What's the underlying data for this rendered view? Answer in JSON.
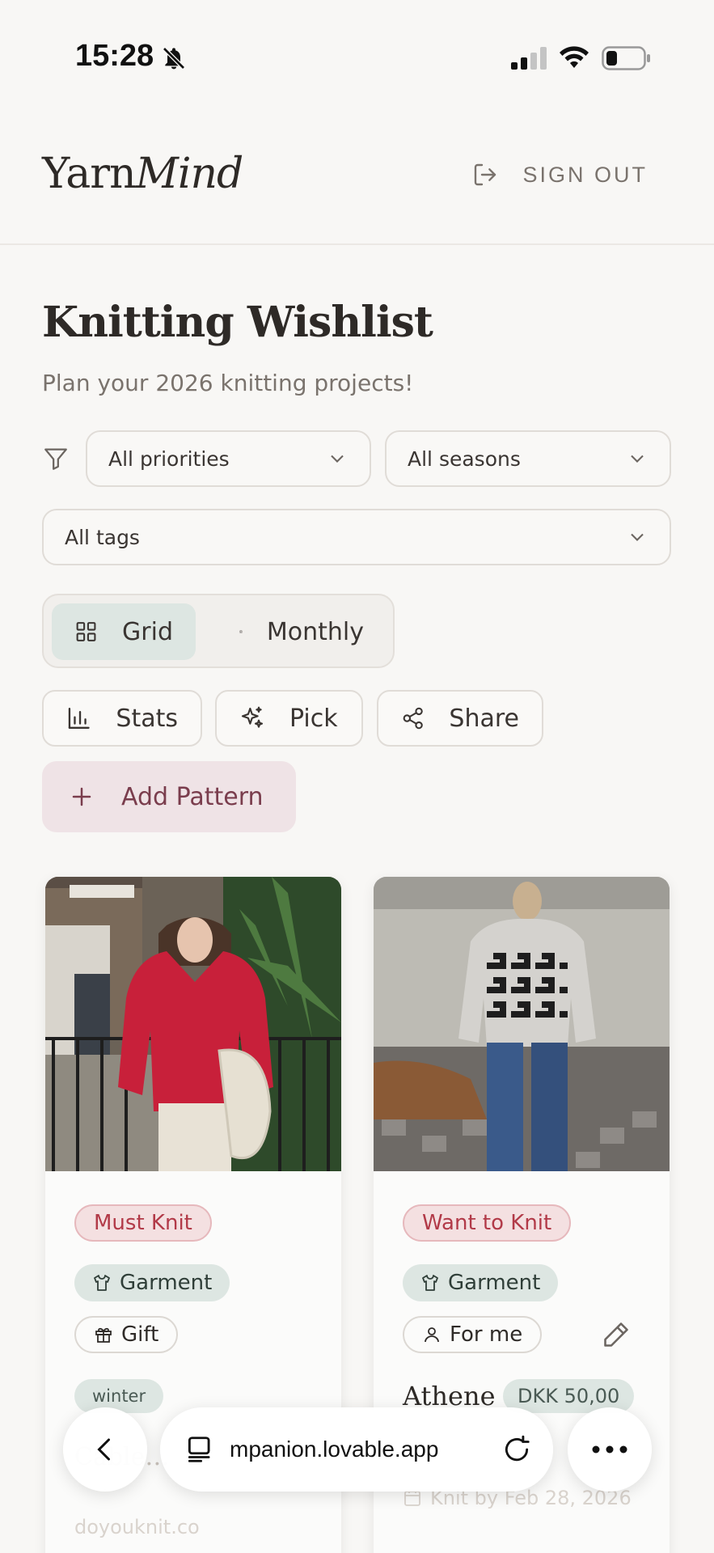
{
  "status_bar": {
    "time": "15:28"
  },
  "header": {
    "logo_part1": "Yarn",
    "logo_part2": "Mind",
    "signout_label": "SIGN OUT"
  },
  "page": {
    "title": "Knitting Wishlist",
    "subtitle": "Plan your 2026 knitting projects!"
  },
  "filters": {
    "priority": "All priorities",
    "season": "All seasons",
    "tags": "All tags"
  },
  "view_toggle": {
    "grid": "Grid",
    "monthly": "Monthly",
    "selected": "Grid"
  },
  "actions": {
    "stats": "Stats",
    "pick": "Pick",
    "share": "Share",
    "add_pattern": "Add Pattern"
  },
  "cards": [
    {
      "priority": "Must Knit",
      "category": "Garment",
      "tag": "Gift",
      "season": "winter",
      "title_partial": "Cable…",
      "source": "doyouknit.co"
    },
    {
      "priority": "Want to Knit",
      "category": "Garment",
      "tag": "For me",
      "title": "Athene",
      "price": "DKK 50,00",
      "due": "Knit by Feb 28, 2026"
    }
  ],
  "browser": {
    "url": "mpanion.lovable.app"
  },
  "colors": {
    "background": "#f8f7f5",
    "accent_rose": "#b23a48",
    "accent_sage": "#dde6e2",
    "add_bg": "#efe3e6"
  }
}
